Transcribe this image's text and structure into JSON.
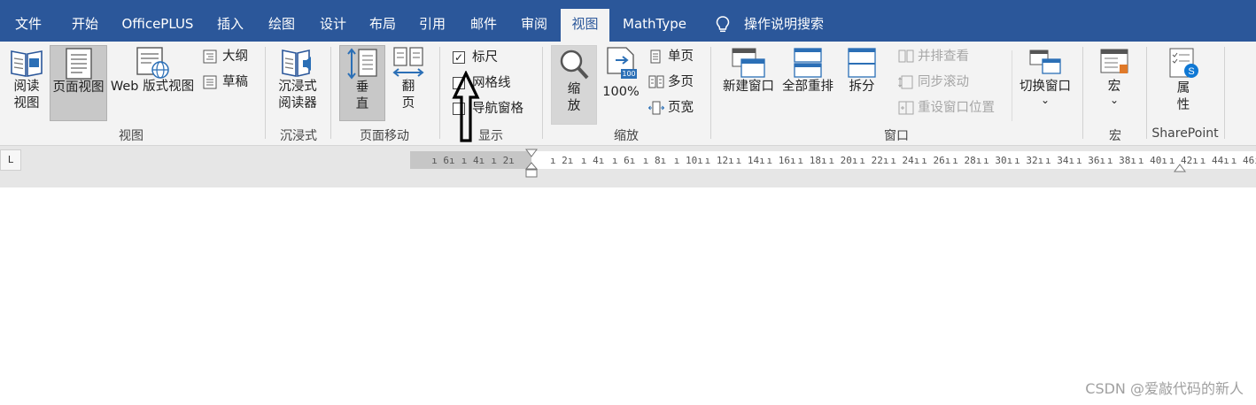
{
  "tabs": [
    {
      "label": "文件"
    },
    {
      "label": "开始"
    },
    {
      "label": "OfficePLUS"
    },
    {
      "label": "插入"
    },
    {
      "label": "绘图"
    },
    {
      "label": "设计"
    },
    {
      "label": "布局"
    },
    {
      "label": "引用"
    },
    {
      "label": "邮件"
    },
    {
      "label": "审阅"
    },
    {
      "label": "视图"
    },
    {
      "label": "MathType"
    }
  ],
  "active_tab": "视图",
  "search": {
    "icon": "lightbulb-icon",
    "label": "操作说明搜索"
  },
  "ribbon": {
    "views": {
      "group_label": "视图",
      "read_mode": "阅读\n视图",
      "read_mode_l1": "阅读",
      "read_mode_l2": "视图",
      "print_layout": "页面视图",
      "web_layout": "Web 版式视图",
      "outline": "大纲",
      "draft": "草稿"
    },
    "immersive": {
      "group_label": "沉浸式",
      "reader_l1": "沉浸式",
      "reader_l2": "阅读器"
    },
    "page_movement": {
      "group_label": "页面移动",
      "vertical_l1": "垂",
      "vertical_l2": "直",
      "side_l1": "翻",
      "side_l2": "页"
    },
    "show": {
      "group_label": "显示",
      "ruler": {
        "label": "标尺",
        "checked": true
      },
      "gridlines": {
        "label": "网格线",
        "checked": false
      },
      "nav_pane": {
        "label": "导航窗格",
        "checked": false
      }
    },
    "zoom": {
      "group_label": "缩放",
      "zoom_l1": "缩",
      "zoom_l2": "放",
      "hundred": "100%",
      "hundred_badge": "100",
      "one_page": "单页",
      "multi_page": "多页",
      "page_width": "页宽"
    },
    "window": {
      "group_label": "窗口",
      "new_window": "新建窗口",
      "arrange_all": "全部重排",
      "split": "拆分",
      "side_by_side": "并排查看",
      "sync_scroll": "同步滚动",
      "reset_position": "重设窗口位置",
      "switch_windows": "切换窗口",
      "switch_arrow": "⌄"
    },
    "macros": {
      "group_label": "宏",
      "macros": "宏",
      "arrow": "⌄"
    },
    "sharepoint": {
      "group_label": "SharePoint",
      "properties_l1": "属",
      "properties_l2": "性"
    }
  },
  "ruler": {
    "tab_selector": "L",
    "left_ticks": [
      "6",
      "4",
      "2"
    ],
    "right_ticks": [
      "2",
      "4",
      "6",
      "8",
      "10",
      "12",
      "14",
      "16",
      "18",
      "20",
      "22",
      "24",
      "26",
      "28",
      "30",
      "32",
      "34",
      "36",
      "38",
      "40",
      "42",
      "44",
      "46"
    ]
  },
  "watermark": "CSDN @爱敲代码的新人",
  "colors": {
    "ribbon_blue": "#2b579a",
    "ribbon_bg": "#f3f3f3",
    "pressed": "#c8c8c8"
  }
}
